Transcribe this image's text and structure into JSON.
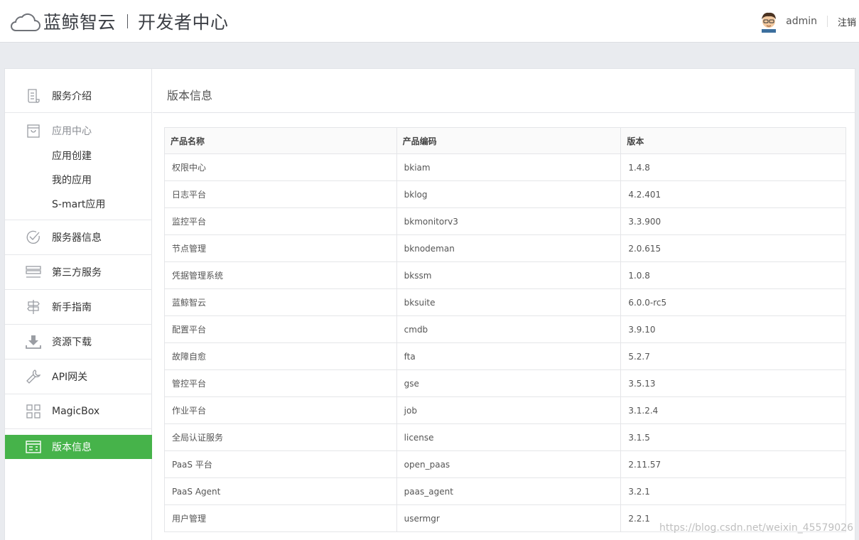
{
  "header": {
    "brand": "蓝鲸智云",
    "subtitle": "开发者中心",
    "username": "admin",
    "logout": "注销"
  },
  "sidebar": {
    "items": [
      {
        "label": "服务介绍",
        "icon": "scroll-icon"
      },
      {
        "label": "应用中心",
        "icon": "bag-icon",
        "children": [
          "应用创建",
          "我的应用",
          "S-mart应用"
        ]
      },
      {
        "label": "服务器信息",
        "icon": "check-circle-icon"
      },
      {
        "label": "第三方服务",
        "icon": "server-stack-icon"
      },
      {
        "label": "新手指南",
        "icon": "signpost-icon"
      },
      {
        "label": "资源下载",
        "icon": "download-icon"
      },
      {
        "label": "API网关",
        "icon": "wrench-icon"
      },
      {
        "label": "MagicBox",
        "icon": "grid-icon"
      },
      {
        "label": "版本信息",
        "icon": "id-card-icon",
        "active": true
      }
    ]
  },
  "content": {
    "title": "版本信息",
    "table": {
      "headers": [
        "产品名称",
        "产品编码",
        "版本"
      ],
      "rows": [
        [
          "权限中心",
          "bkiam",
          "1.4.8"
        ],
        [
          "日志平台",
          "bklog",
          "4.2.401"
        ],
        [
          "监控平台",
          "bkmonitorv3",
          "3.3.900"
        ],
        [
          "节点管理",
          "bknodeman",
          "2.0.615"
        ],
        [
          "凭据管理系统",
          "bkssm",
          "1.0.8"
        ],
        [
          "蓝鲸智云",
          "bksuite",
          "6.0.0-rc5"
        ],
        [
          "配置平台",
          "cmdb",
          "3.9.10"
        ],
        [
          "故障自愈",
          "fta",
          "5.2.7"
        ],
        [
          "管控平台",
          "gse",
          "3.5.13"
        ],
        [
          "作业平台",
          "job",
          "3.1.2.4"
        ],
        [
          "全局认证服务",
          "license",
          "3.1.5"
        ],
        [
          "PaaS 平台",
          "open_paas",
          "2.11.57"
        ],
        [
          "PaaS Agent",
          "paas_agent",
          "3.2.1"
        ],
        [
          "用户管理",
          "usermgr",
          "2.2.1"
        ]
      ]
    }
  },
  "watermark": "https://blog.csdn.net/weixin_45579026",
  "colors": {
    "accent": "#46b34a",
    "background": "#e9ebef"
  }
}
